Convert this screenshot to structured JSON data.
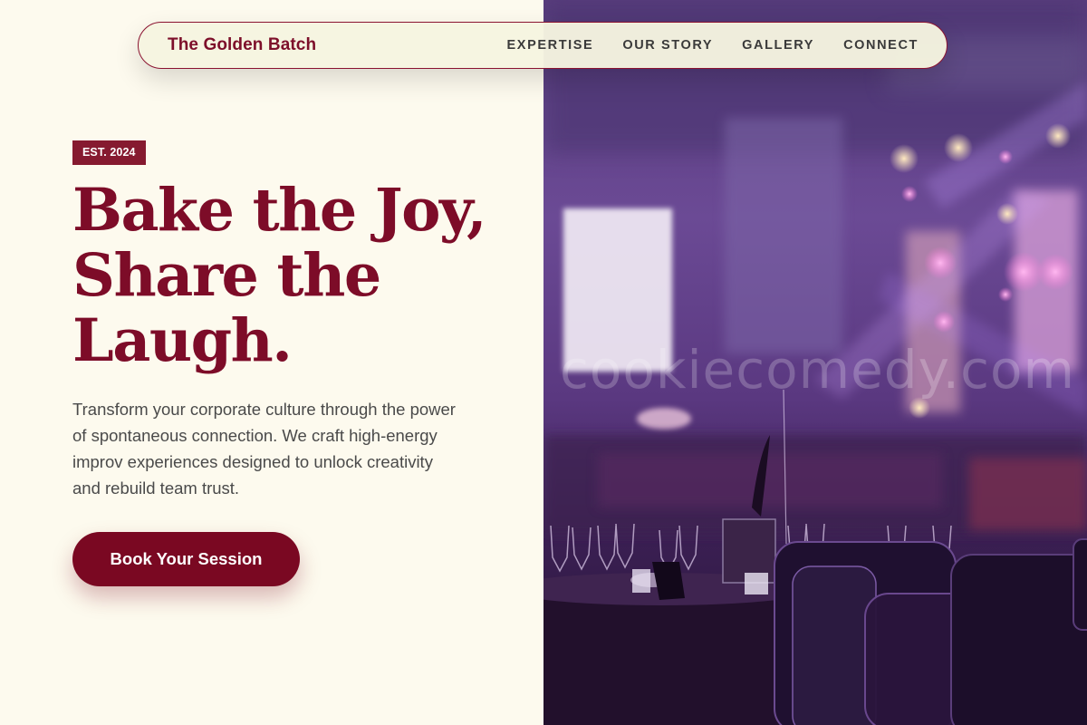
{
  "brand": "The Golden Batch",
  "nav": [
    {
      "label": "EXPERTISE"
    },
    {
      "label": "OUR STORY"
    },
    {
      "label": "GALLERY"
    },
    {
      "label": "CONNECT"
    }
  ],
  "hero": {
    "badge": "EST. 2024",
    "headline": [
      "Bake the Joy,",
      "Share the",
      "Laugh."
    ],
    "lead": "Transform your corporate culture through the power of spontaneous connection. We craft high-energy improv experiences designed to unlock creativity and rebuild team trust.",
    "cta": "Book Your Session"
  },
  "image": {
    "watermark": "cookiecomedy.com"
  },
  "colors": {
    "accent": "#7a0822",
    "cream": "#fdfaee",
    "nav_bg": "#f6f5e0",
    "text": "#4a4a4a"
  }
}
